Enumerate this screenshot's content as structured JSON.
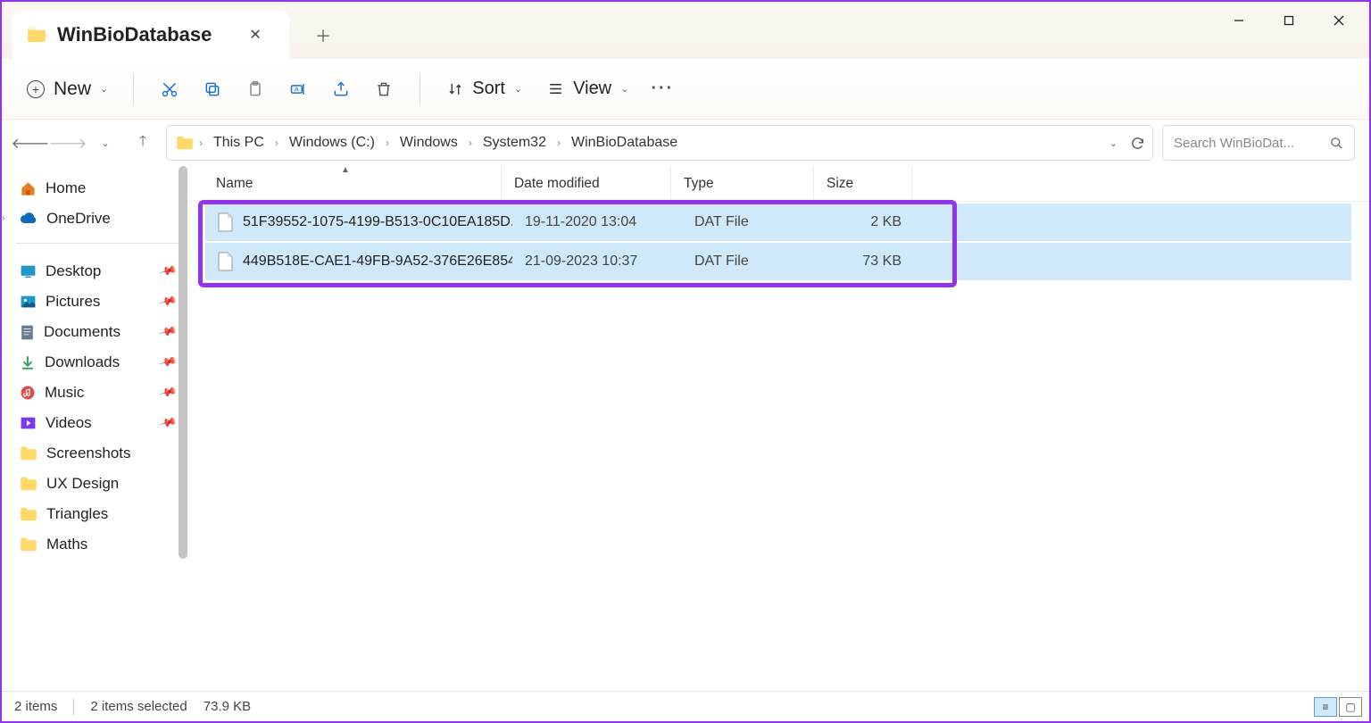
{
  "tab": {
    "title": "WinBioDatabase"
  },
  "toolbar": {
    "new_label": "New",
    "sort_label": "Sort",
    "view_label": "View"
  },
  "breadcrumbs": [
    "This PC",
    "Windows (C:)",
    "Windows",
    "System32",
    "WinBioDatabase"
  ],
  "search": {
    "placeholder": "Search WinBioDat..."
  },
  "sidebar": {
    "home": "Home",
    "onedrive": "OneDrive",
    "quick": [
      "Desktop",
      "Pictures",
      "Documents",
      "Downloads",
      "Music",
      "Videos"
    ],
    "folders": [
      "Screenshots",
      "UX Design",
      "Triangles",
      "Maths"
    ]
  },
  "columns": {
    "name": "Name",
    "date": "Date modified",
    "type": "Type",
    "size": "Size"
  },
  "files": [
    {
      "name": "51F39552-1075-4199-B513-0C10EA185D...",
      "date": "19-11-2020 13:04",
      "type": "DAT File",
      "size": "2 KB"
    },
    {
      "name": "449B518E-CAE1-49FB-9A52-376E26E854...",
      "date": "21-09-2023 10:37",
      "type": "DAT File",
      "size": "73 KB"
    }
  ],
  "status": {
    "count": "2 items",
    "selected": "2 items selected",
    "size": "73.9 KB"
  }
}
